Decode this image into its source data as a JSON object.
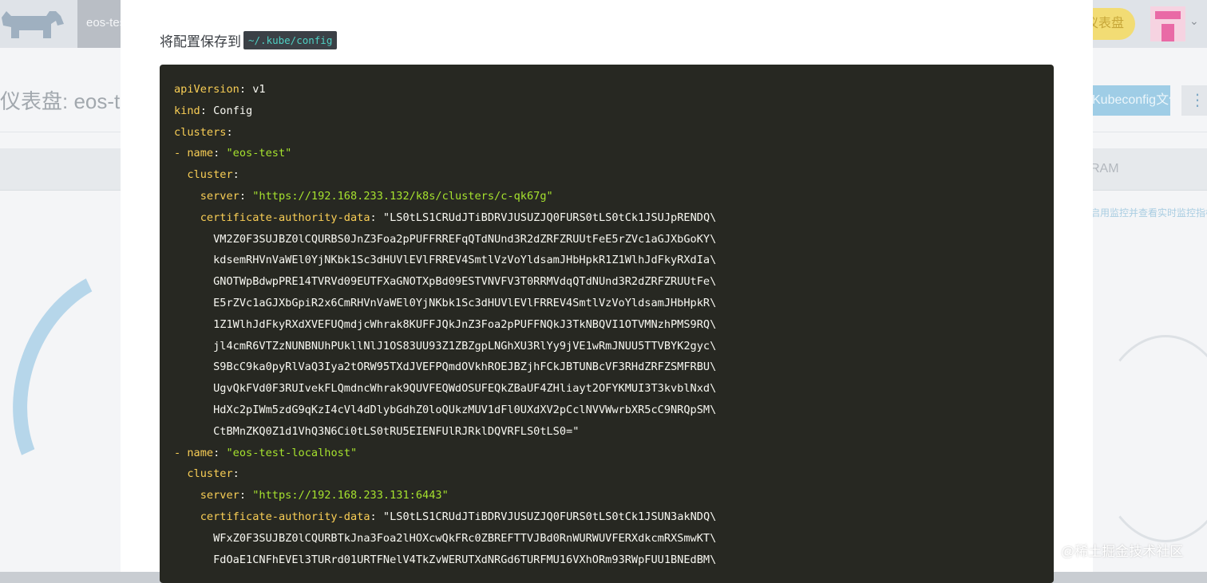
{
  "background": {
    "cluster_tab": "eos-test",
    "header_pill": "仪表盘",
    "page_title": "仪表盘: eos-test",
    "kubeconfig_button": "Kubeconfig文件",
    "more_button": "⋮",
    "band_label": "RAM",
    "hint": "启用监控并查看实时监控指标"
  },
  "modal": {
    "heading": "将配置保存到",
    "path": "~/.kube/config"
  },
  "code_lines": [
    {
      "indent": "",
      "key": "apiVersion",
      "value": "v1",
      "type": "plain"
    },
    {
      "indent": "",
      "key": "kind",
      "value": "Config",
      "type": "plain"
    },
    {
      "indent": "",
      "key": "clusters",
      "value": "",
      "type": "plain"
    },
    {
      "indent": "- ",
      "key": "name",
      "value": "\"eos-test\"",
      "type": "string"
    },
    {
      "indent": "  ",
      "key": "cluster",
      "value": "",
      "type": "plain"
    },
    {
      "indent": "    ",
      "key": "server",
      "value": "\"https://192.168.233.132/k8s/clusters/c-qk67g\"",
      "type": "string"
    },
    {
      "indent": "    ",
      "key": "certificate-authority-data",
      "value": "\"LS0tLS1CRUdJTiBDRVJUSUZJQ0FURS0tLS0tCk1JSUJpRENDQ\\",
      "type": "plain"
    },
    {
      "indent": "      ",
      "key": "",
      "value": "VM2Z0F3SUJBZ0lCQURBS0JnZ3Foa2pPUFFRREFqQTdNUnd3R2dZRFZRUUtFeE5rZVc1aGJXbGoKY\\",
      "type": "plain"
    },
    {
      "indent": "      ",
      "key": "",
      "value": "kdsemRHVnVaWEl0YjNKbk1Sc3dHUVlEVlFRREV4SmtlVzVoYldsamJHbHpkR1Z1WlhJdFkyRXdIa\\",
      "type": "plain"
    },
    {
      "indent": "      ",
      "key": "",
      "value": "GNOTWpBdwpPRE14TVRVd09EUTFXaGNOTXpBd09ESTVNVFV3T0RRMVdqQTdNUnd3R2dZRFZRUUtFe\\",
      "type": "plain"
    },
    {
      "indent": "      ",
      "key": "",
      "value": "E5rZVc1aGJXbGpiR2x6CmRHVnVaWEl0YjNKbk1Sc3dHUVlEVlFRREV4SmtlVzVoYldsamJHbHpkR\\",
      "type": "plain"
    },
    {
      "indent": "      ",
      "key": "",
      "value": "1Z1WlhJdFkyRXdXVEFUQmdjcWhrak8KUFFJQkJnZ3Foa2pPUFFNQkJ3TkNBQVI1OTVMNzhPMS9RQ\\",
      "type": "plain"
    },
    {
      "indent": "      ",
      "key": "",
      "value": "jl4cmR6VTZzNUNBNUhPUkllNlJ1OS83UU93Z1ZBZgpLNGhXU3RlYy9jVE1wRmJNUU5TTVBYK2gyc\\",
      "type": "plain"
    },
    {
      "indent": "      ",
      "key": "",
      "value": "S9BcC9ka0pyRlVaQ3Iya2tORW95TXdJVEFPQmdOVkhROEJBZjhFCkJBTUNBcVF3RHdZRFZSMFRBU\\",
      "type": "plain"
    },
    {
      "indent": "      ",
      "key": "",
      "value": "UgvQkFVd0F3RUIvekFLQmdncWhrak9QUVFEQWdOSUFEQkZBaUF4ZHliayt2OFYKMUI3T3kvblNxd\\",
      "type": "plain"
    },
    {
      "indent": "      ",
      "key": "",
      "value": "HdXc2pIWm5zdG9qKzI4cVl4dDlybGdhZ0loQUkzMUV1dFl0UXdXV2pCclNVVWwrbXR5cC9NRQpSM\\",
      "type": "plain"
    },
    {
      "indent": "      ",
      "key": "",
      "value": "CtBMnZKQ0Z1d1VhQ3N6Ci0tLS0tRU5EIENFUlRJRklDQVRFLS0tLS0=\"",
      "type": "plain"
    },
    {
      "indent": "- ",
      "key": "name",
      "value": "\"eos-test-localhost\"",
      "type": "string"
    },
    {
      "indent": "  ",
      "key": "cluster",
      "value": "",
      "type": "plain"
    },
    {
      "indent": "    ",
      "key": "server",
      "value": "\"https://192.168.233.131:6443\"",
      "type": "string"
    },
    {
      "indent": "    ",
      "key": "certificate-authority-data",
      "value": "\"LS0tLS1CRUdJTiBDRVJUSUZJQ0FURS0tLS0tCk1JSUN3akNDQ\\",
      "type": "plain"
    },
    {
      "indent": "      ",
      "key": "",
      "value": "WFxZ0F3SUJBZ0lCQURBTkJna3Foa2lHOXcwQkFRc0ZBREFTTVJBd0RnWURWUVFERXdkcmRXSmwKT\\",
      "type": "plain"
    },
    {
      "indent": "      ",
      "key": "",
      "value": "FdOaE1CNFhEVEl3TURrd01URTFNelV4TkZvWERUTXdNRGd6TURFMU16VXhORm93RWpFUU1BNEdBM\\",
      "type": "plain"
    }
  ],
  "watermark": "@稀土掘金技术社区",
  "colors": {
    "code_bg": "#272822",
    "code_key": "#f9ce55",
    "code_string": "#a6e22e",
    "code_text": "#f8f8f2",
    "path_chip_bg": "#3b4046",
    "path_chip_text": "#4fd0c4"
  }
}
